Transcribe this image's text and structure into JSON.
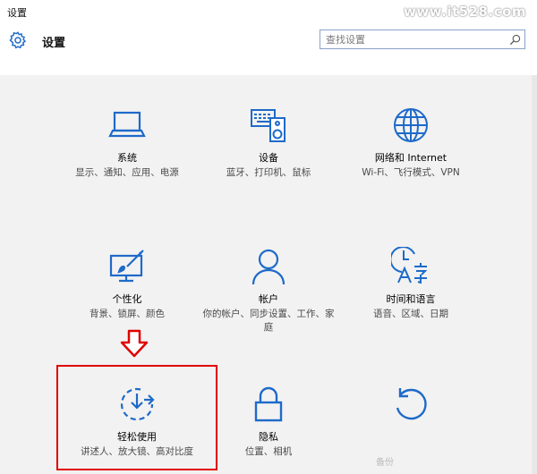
{
  "window": {
    "title": "设置",
    "watermark": "www.it528.com"
  },
  "header": {
    "title": "设置",
    "search_placeholder": "查找设置"
  },
  "colors": {
    "icon": "#1e6ac9",
    "highlight": "#e00000"
  },
  "tiles": [
    {
      "title": "系统",
      "desc": "显示、通知、应用、电源",
      "icon": "laptop-icon"
    },
    {
      "title": "设备",
      "desc": "蓝牙、打印机、鼠标",
      "icon": "devices-icon"
    },
    {
      "title": "网络和 Internet",
      "desc": "Wi-Fi、飞行模式、VPN",
      "icon": "globe-icon"
    },
    {
      "title": "个性化",
      "desc": "背景、锁屏、颜色",
      "icon": "personalization-icon"
    },
    {
      "title": "帐户",
      "desc": "你的帐户、同步设置、工作、家庭",
      "icon": "person-icon"
    },
    {
      "title": "时间和语言",
      "desc": "语音、区域、日期",
      "icon": "time-language-icon"
    },
    {
      "title": "轻松使用",
      "desc": "讲述人、放大镜、高对比度",
      "icon": "ease-of-access-icon"
    },
    {
      "title": "隐私",
      "desc": "位置、相机",
      "icon": "lock-icon"
    },
    {
      "title": "",
      "desc": "",
      "icon": "update-icon"
    }
  ],
  "bottom_partial_text": "备份"
}
